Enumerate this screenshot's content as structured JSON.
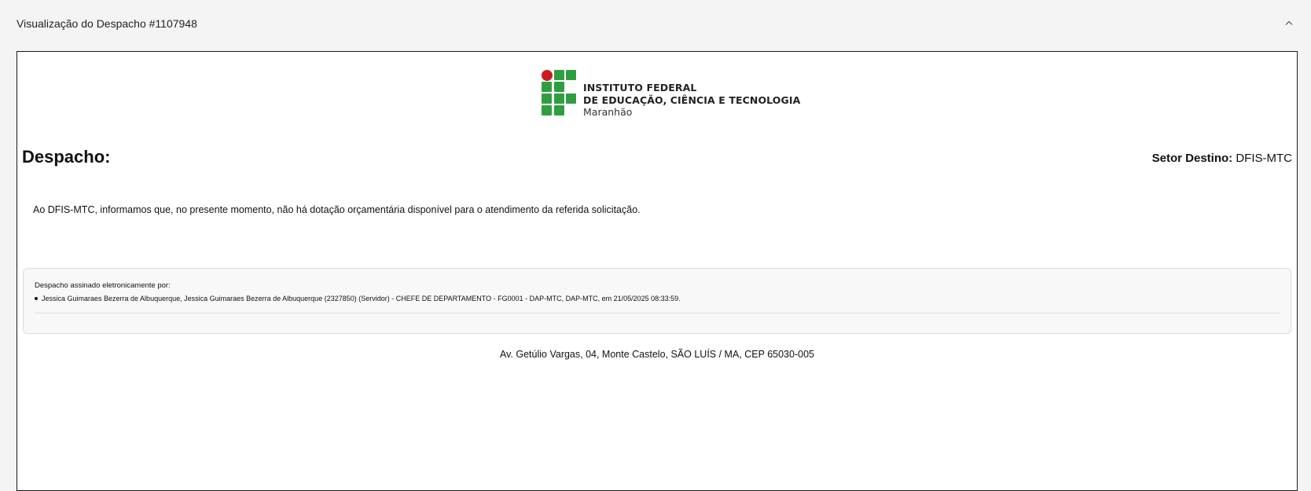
{
  "panel": {
    "title": "Visualização do Despacho #1107948",
    "toggle_icon": "chevron-up-icon"
  },
  "logo": {
    "line1": "INSTITUTO FEDERAL",
    "line2": "DE EDUCAÇÃO, CIÊNCIA E TECNOLOGIA",
    "line3": "Maranhão",
    "colors": {
      "green": "#2f9e41",
      "red": "#cd191e"
    }
  },
  "document": {
    "heading": "Despacho:",
    "destination_label": "Setor Destino:",
    "destination_value": "DFIS-MTC",
    "body": "Ao DFIS-MTC, informamos que, no presente momento, não há dotação orçamentária disponível para o atendimento da referida solicitação.",
    "signature": {
      "title": "Despacho assinado eletronicamente por:",
      "signers": [
        "Jessica Guimaraes Bezerra de Albuquerque, Jessica Guimaraes Bezerra de Albuquerque (2327850) (Servidor) - CHEFE DE DEPARTAMENTO - FG0001 - DAP-MTC, DAP-MTC, em 21/05/2025 08:33:59."
      ]
    },
    "address": "Av. Getúlio Vargas, 04, Monte Castelo, SÃO LUÍS / MA, CEP 65030-005"
  }
}
